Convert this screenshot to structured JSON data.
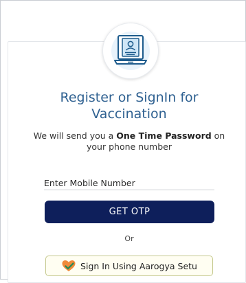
{
  "login": {
    "title": "Register or SignIn for Vaccination",
    "subtitle_prefix": "We will send you a ",
    "subtitle_bold": "One Time Password",
    "subtitle_suffix": " on your phone number",
    "mobile_placeholder": "Enter Mobile Number",
    "otp_button_label": "GET OTP",
    "or_label": "Or",
    "aarogya_button_label": "Sign In Using Aarogya Setu",
    "logo_icon": "laptop-profile-icon",
    "heart_icon": "aarogya-setu-heart-icon"
  },
  "colors": {
    "title": "#2f6191",
    "otp_button_bg": "#0e1f5b",
    "aarogya_button_bg": "#fffef2",
    "aarogya_button_border": "#c5c98e",
    "heart": "#f08a3a",
    "check": "#2e8b57"
  }
}
